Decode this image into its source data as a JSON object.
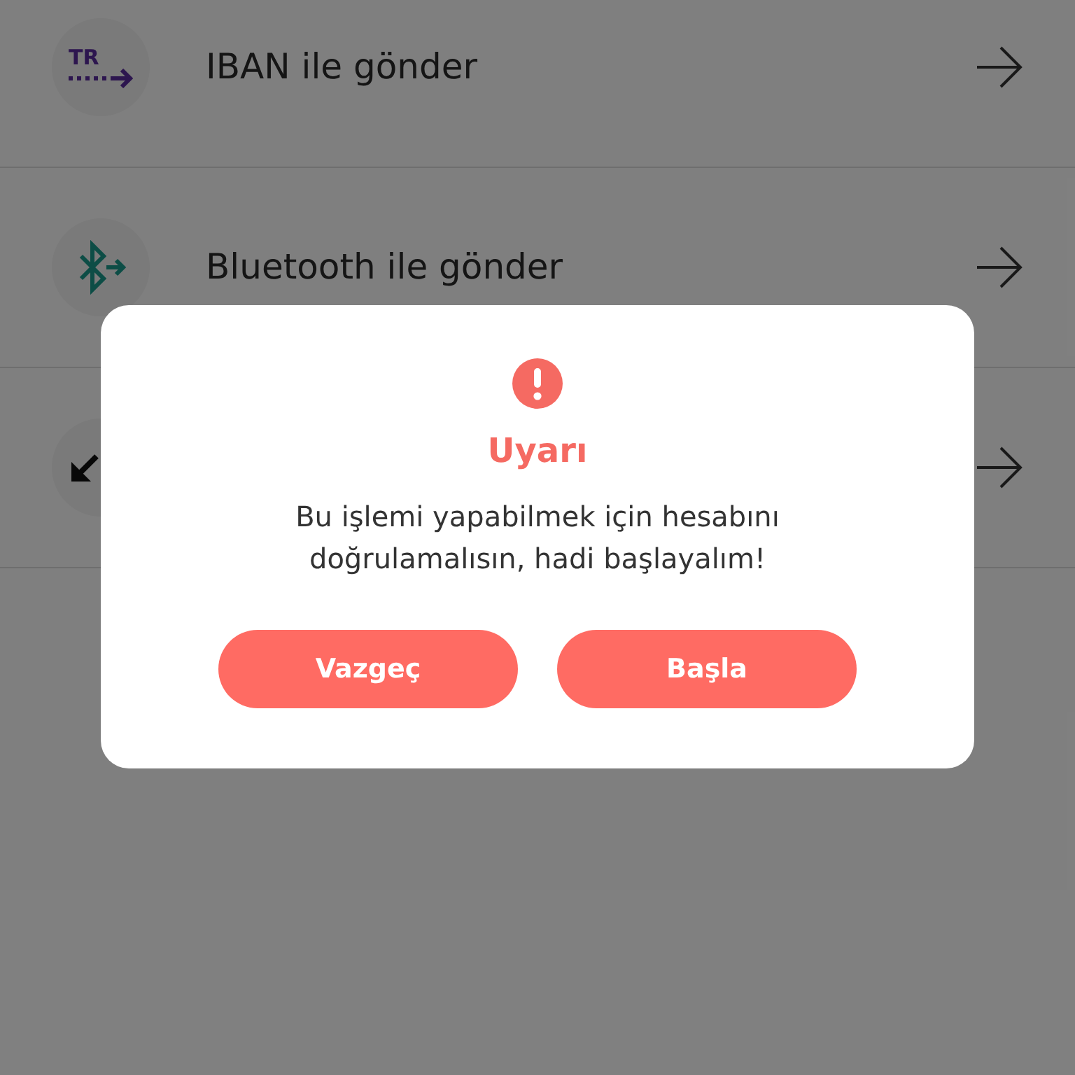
{
  "rows": [
    {
      "kind": "iban",
      "icon_text": "TR",
      "label": "IBAN ile gönder"
    },
    {
      "kind": "bluetooth",
      "label": "Bluetooth ile gönder"
    },
    {
      "kind": "receive"
    }
  ],
  "dialog": {
    "title": "Uyarı",
    "message": "Bu işlemi yapabilmek için hesabını doğrulamalısın, hadi başlayalım!",
    "buttons": [
      "Vazgeç",
      "Başla"
    ]
  }
}
